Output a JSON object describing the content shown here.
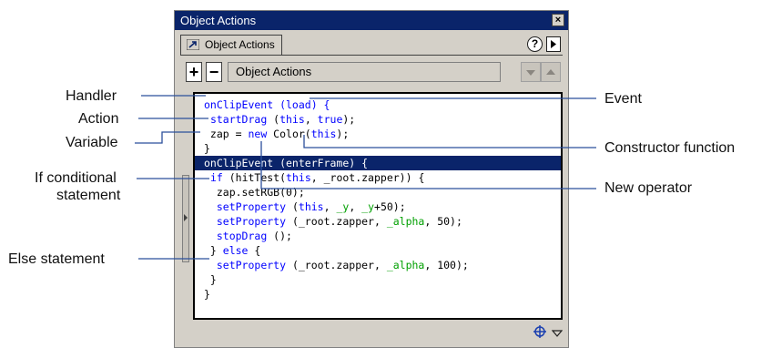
{
  "window": {
    "title": "Object Actions",
    "tab_label": "Object Actions",
    "help_label": "?",
    "dropdown_label": "Object Actions",
    "add_label": "+",
    "remove_label": "−",
    "close_label": "×"
  },
  "code_lines": [
    {
      "segments": [
        {
          "text": "onClipEvent (load) {",
          "color": "blue"
        }
      ]
    },
    {
      "segments": [
        {
          "text": " "
        },
        {
          "text": "startDrag",
          "color": "blue"
        },
        {
          "text": " ("
        },
        {
          "text": "this",
          "color": "blue"
        },
        {
          "text": ", "
        },
        {
          "text": "true",
          "color": "blue"
        },
        {
          "text": ");"
        }
      ]
    },
    {
      "segments": [
        {
          "text": " zap = "
        },
        {
          "text": "new",
          "color": "blue"
        },
        {
          "text": " Color("
        },
        {
          "text": "this",
          "color": "blue"
        },
        {
          "text": ");"
        }
      ]
    },
    {
      "segments": [
        {
          "text": "}"
        }
      ]
    },
    {
      "segments": [
        {
          "text": "onClipEvent (enterFrame) {"
        }
      ],
      "selected": true
    },
    {
      "segments": [
        {
          "text": " "
        },
        {
          "text": "if",
          "color": "blue"
        },
        {
          "text": " (hitTest("
        },
        {
          "text": "this",
          "color": "blue"
        },
        {
          "text": ", _root.zapper)) {"
        }
      ]
    },
    {
      "segments": [
        {
          "text": "  zap.setRGB(0);"
        }
      ]
    },
    {
      "segments": [
        {
          "text": "  "
        },
        {
          "text": "setProperty",
          "color": "blue"
        },
        {
          "text": " ("
        },
        {
          "text": "this",
          "color": "blue"
        },
        {
          "text": ", "
        },
        {
          "text": "_y",
          "color": "green"
        },
        {
          "text": ", "
        },
        {
          "text": "_y",
          "color": "green"
        },
        {
          "text": "+50);"
        }
      ]
    },
    {
      "segments": [
        {
          "text": "  "
        },
        {
          "text": "setProperty",
          "color": "blue"
        },
        {
          "text": " (_root.zapper, "
        },
        {
          "text": "_alpha",
          "color": "green"
        },
        {
          "text": ", 50);"
        }
      ]
    },
    {
      "segments": [
        {
          "text": "  "
        },
        {
          "text": "stopDrag",
          "color": "blue"
        },
        {
          "text": " ();"
        }
      ]
    },
    {
      "segments": [
        {
          "text": " } "
        },
        {
          "text": "else",
          "color": "blue"
        },
        {
          "text": " {"
        }
      ]
    },
    {
      "segments": [
        {
          "text": "  "
        },
        {
          "text": "setProperty",
          "color": "blue"
        },
        {
          "text": " (_root.zapper, "
        },
        {
          "text": "_alpha",
          "color": "green"
        },
        {
          "text": ", 100);"
        }
      ]
    },
    {
      "segments": [
        {
          "text": " }"
        }
      ]
    },
    {
      "segments": [
        {
          "text": "}"
        }
      ]
    }
  ],
  "callouts": {
    "handler": "Handler",
    "action": "Action",
    "variable": "Variable",
    "if_line1": "If conditional",
    "if_line2": "statement",
    "else_statement": "Else statement",
    "event": "Event",
    "constructor": "Constructor function",
    "new_operator": "New operator"
  },
  "colors": {
    "titlebar": "#0a246a",
    "selection": "#0a246a",
    "keyword": "#0000ff",
    "property": "#00a000",
    "leader_line": "#2b4f9c",
    "panel": "#d4d0c8"
  }
}
